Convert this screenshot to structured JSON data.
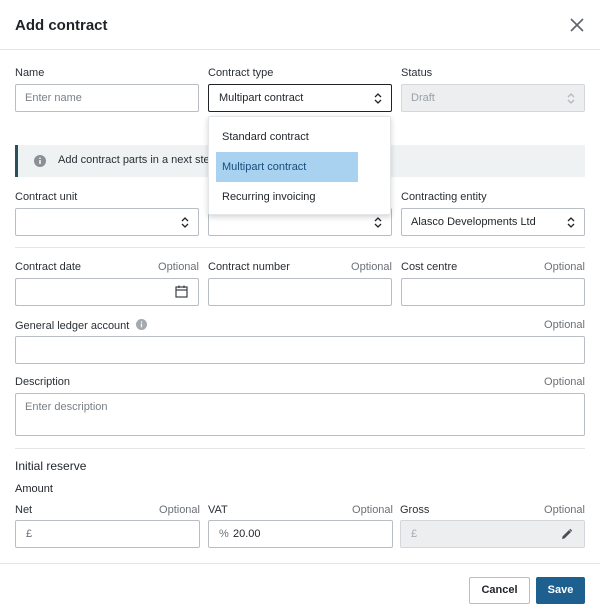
{
  "dialog": {
    "title": "Add contract"
  },
  "fields": {
    "name": {
      "label": "Name",
      "placeholder": "Enter name"
    },
    "contract_type": {
      "label": "Contract type",
      "value": "Multipart contract"
    },
    "status": {
      "label": "Status",
      "value": "Draft"
    },
    "contract_unit": {
      "label": "Contract unit",
      "value": ""
    },
    "contracting_entity": {
      "label": "Contracting entity",
      "value": "Alasco Developments Ltd"
    },
    "contract_date": {
      "label": "Contract date",
      "optional": "Optional"
    },
    "contract_number": {
      "label": "Contract number",
      "optional": "Optional"
    },
    "cost_centre": {
      "label": "Cost centre",
      "optional": "Optional"
    },
    "gl_account": {
      "label": "General ledger account",
      "optional": "Optional"
    },
    "description": {
      "label": "Description",
      "optional": "Optional",
      "placeholder": "Enter description"
    }
  },
  "info_banner": {
    "text": "Add contract parts in a next ste"
  },
  "dropdown": {
    "options": [
      "Standard contract",
      "Multipart contract",
      "Recurring invoicing"
    ],
    "selected_index": 1
  },
  "reserve": {
    "section_title": "Initial reserve",
    "amount_label": "Amount",
    "net": {
      "label": "Net",
      "optional": "Optional",
      "prefix": "£"
    },
    "vat": {
      "label": "VAT",
      "optional": "Optional",
      "prefix": "%",
      "value": "20.00"
    },
    "gross": {
      "label": "Gross",
      "optional": "Optional",
      "prefix": "£"
    }
  },
  "footer": {
    "cancel_label": "Cancel",
    "save_label": "Save"
  },
  "colors": {
    "primary": "#1d5f8f",
    "selected_option": "#a8d2f0",
    "info_bg": "#eef2f2"
  }
}
